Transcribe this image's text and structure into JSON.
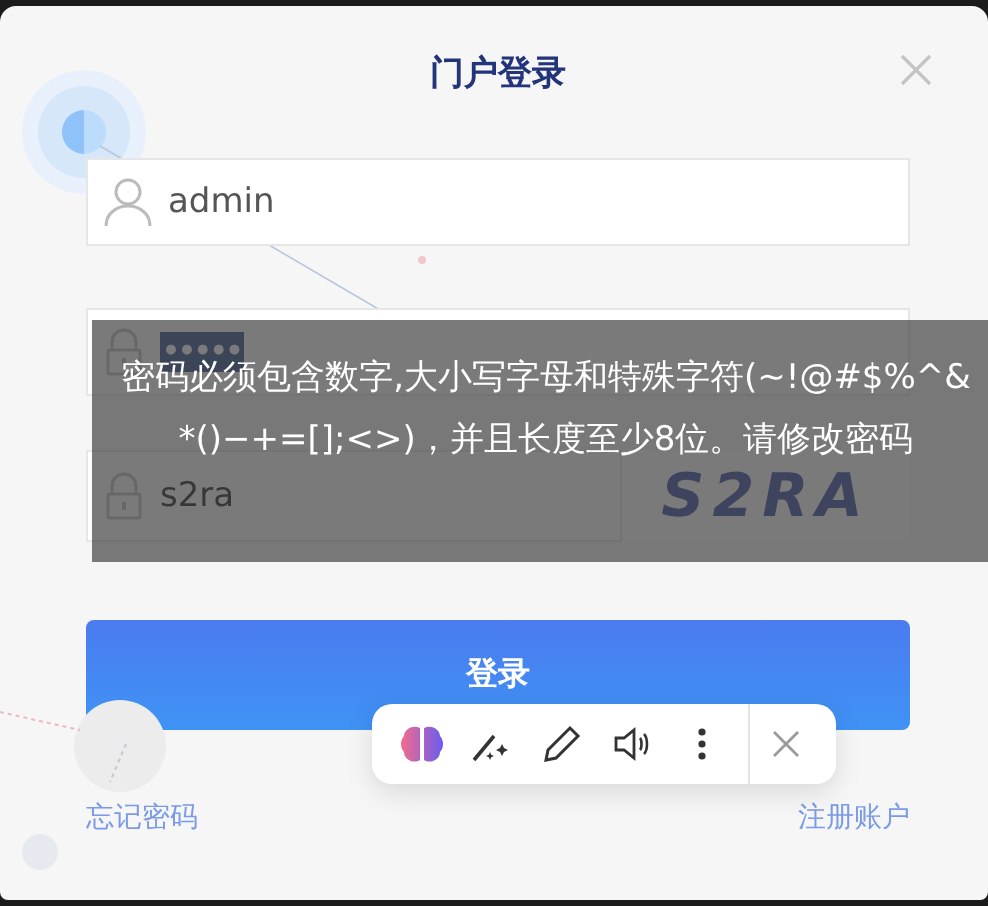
{
  "dialog": {
    "title": "门户登录"
  },
  "username": {
    "value": "admin"
  },
  "password": {
    "value": "•••••",
    "value_selected": true
  },
  "captcha": {
    "value": "s2ra",
    "image_text": "S2RA"
  },
  "tooltip": {
    "text": "密码必须包含数字,大小写字母和特殊字符(~!@#$%^&*()−+=[];<>)，并且长度至少8位。请修改密码"
  },
  "login_button": {
    "label": "登录"
  },
  "links": [
    {
      "label": "忘记密码"
    },
    {
      "label": "注册账户"
    }
  ]
}
